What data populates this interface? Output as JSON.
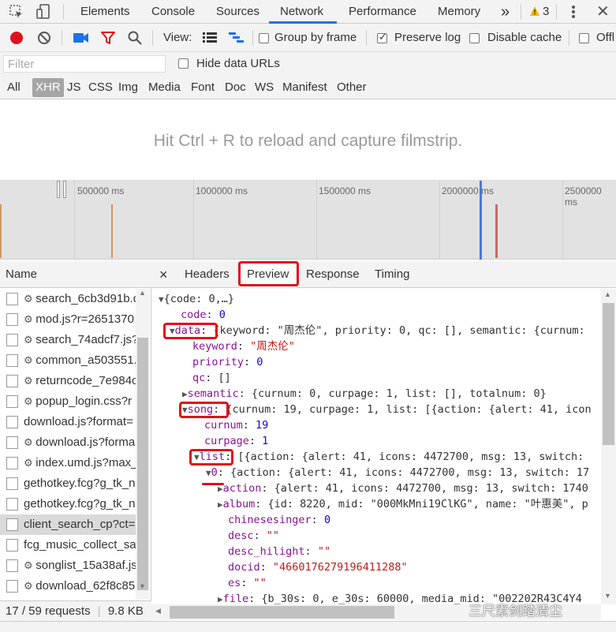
{
  "devtools": {
    "tabs": [
      "Elements",
      "Console",
      "Sources",
      "Network",
      "Performance",
      "Memory"
    ],
    "active_tab": "Network",
    "more_tabs": "»",
    "warning_count": "3",
    "warning_icon": "warning-triangle-icon"
  },
  "toolbar": {
    "view_label": "View:",
    "group_by_frame": "Group by frame",
    "preserve_log": "Preserve log",
    "preserve_log_checked": true,
    "disable_cache": "Disable cache",
    "offline": "Offl"
  },
  "filter": {
    "placeholder": "Filter",
    "hide_data_urls": "Hide data URLs"
  },
  "types": [
    "All",
    "XHR",
    "JS",
    "CSS",
    "Img",
    "Media",
    "Font",
    "Doc",
    "WS",
    "Manifest",
    "Other"
  ],
  "active_type": "XHR",
  "filmstrip_message": "Hit Ctrl + R to reload and capture filmstrip.",
  "overview_labels": [
    "500000 ms",
    "1000000 ms",
    "1500000 ms",
    "2000000 ms",
    "2500000 ms"
  ],
  "requests": {
    "header": "Name",
    "items": [
      {
        "name": "search_6cb3d91b.c",
        "gear": true
      },
      {
        "name": "mod.js?r=2651370",
        "gear": true
      },
      {
        "name": "search_74adcf7.js?",
        "gear": true
      },
      {
        "name": "common_a503551.",
        "gear": true
      },
      {
        "name": "returncode_7e984c",
        "gear": true
      },
      {
        "name": "popup_login.css?r",
        "gear": true
      },
      {
        "name": "download.js?format=",
        "gear": false
      },
      {
        "name": "download.js?forma",
        "gear": true
      },
      {
        "name": "index.umd.js?max_",
        "gear": true
      },
      {
        "name": "gethotkey.fcg?g_tk_n",
        "gear": false
      },
      {
        "name": "gethotkey.fcg?g_tk_n",
        "gear": false
      },
      {
        "name": "client_search_cp?ct=2",
        "gear": false
      },
      {
        "name": "fcg_music_collect_saf",
        "gear": false
      },
      {
        "name": "songlist_15a38af.js",
        "gear": true
      },
      {
        "name": "download_62f8c85",
        "gear": true
      }
    ],
    "selected_index": 11,
    "status": "17 / 59 requests",
    "size": "9.8 KB"
  },
  "detail": {
    "close": "×",
    "tabs": [
      "Headers",
      "Preview",
      "Response",
      "Timing"
    ],
    "active_tab": "Preview"
  },
  "preview": {
    "l1": "{code: 0,…}",
    "l2_key": "code",
    "l2_val": "0",
    "l3_key": "data",
    "l3_rest": "{keyword: \"周杰伦\", priority: 0, qc: [], semantic: {curnum:",
    "l4_key": "keyword",
    "l4_val": "\"周杰伦\"",
    "l5_key": "priority",
    "l5_val": "0",
    "l6_key": "qc",
    "l6_val": "[]",
    "l7_key": "semantic",
    "l7_rest": "{curnum: 0, curpage: 1, list: [], totalnum: 0}",
    "l8_key": "song",
    "l8_rest": "{curnum: 19, curpage: 1, list: [{action: {alert: 41, icon",
    "l9_key": "curnum",
    "l9_val": "19",
    "l10_key": "curpage",
    "l10_val": "1",
    "l11_key": "list",
    "l11_rest": "[{action: {alert: 41, icons: 4472700, msg: 13, switch:",
    "l12_key": "0",
    "l12_rest": "{action: {alert: 41, icons: 4472700, msg: 13, switch: 17",
    "l13_key": "action",
    "l13_rest": "{alert: 41, icons: 4472700, msg: 13, switch: 1740",
    "l14_key": "album",
    "l14_rest": "{id: 8220, mid: \"000MkMni19ClKG\", name: \"叶惠美\", p",
    "l15_key": "chinesesinger",
    "l15_val": "0",
    "l16_key": "desc",
    "l16_val": "\"\"",
    "l17_key": "desc_hilight",
    "l17_val": "\"\"",
    "l18_key": "docid",
    "l18_val": "\"4660176279196411288\"",
    "l19_key": "es",
    "l19_val": "\"\"",
    "l20_key": "file",
    "l20_rest": "{b_30s: 0, e_30s: 60000, media_mid: \"002202R43C4Y4"
  },
  "watermark": "三尺素剑踏清尘",
  "colors": {
    "highlight_red": "#e0101a",
    "active_tab_blue": "#1a73e8",
    "record_red": "#e0101a",
    "camera_blue": "#1a73e8",
    "funnel_red": "#e0101a"
  }
}
